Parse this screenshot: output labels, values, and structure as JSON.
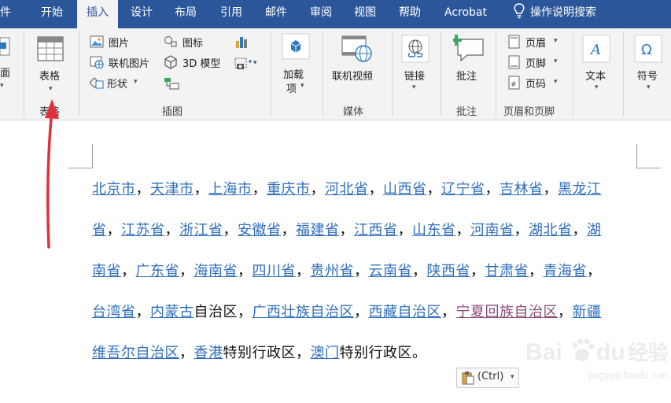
{
  "tabs": [
    {
      "label": "件"
    },
    {
      "label": "开始"
    },
    {
      "label": "插入"
    },
    {
      "label": "设计"
    },
    {
      "label": "布局"
    },
    {
      "label": "引用"
    },
    {
      "label": "邮件"
    },
    {
      "label": "审阅"
    },
    {
      "label": "视图"
    },
    {
      "label": "帮助"
    },
    {
      "label": "Acrobat"
    },
    {
      "label": "操作说明搜索"
    }
  ],
  "ribbon": {
    "cut_label": "面",
    "table": {
      "button": "表格",
      "group": "表格"
    },
    "illustrations": {
      "picture": "图片",
      "online_picture": "联机图片",
      "shapes": "形状",
      "icons": "图标",
      "model3d": "3D 模型",
      "group": "插图"
    },
    "addins": {
      "line1": "加载",
      "line2": "项"
    },
    "media": {
      "online_video": "联机视频",
      "group": "媒体"
    },
    "links": {
      "button": "链接"
    },
    "comments": {
      "button": "批注",
      "group": "批注"
    },
    "header_footer": {
      "header": "页眉",
      "footer": "页脚",
      "page_number": "页码",
      "group": "页眉和页脚"
    },
    "text": {
      "button": "文本"
    },
    "symbols": {
      "button": "符号"
    }
  },
  "document": {
    "lines": [
      [
        {
          "t": "北京市",
          "l": 1
        },
        {
          "t": "，"
        },
        {
          "t": "天津市",
          "l": 1
        },
        {
          "t": "，"
        },
        {
          "t": "上海市",
          "l": 1
        },
        {
          "t": "，"
        },
        {
          "t": "重庆市",
          "l": 1
        },
        {
          "t": "，"
        },
        {
          "t": "河北省",
          "l": 1
        },
        {
          "t": "，"
        },
        {
          "t": "山西省",
          "l": 1
        },
        {
          "t": "，"
        },
        {
          "t": "辽宁省",
          "l": 1
        },
        {
          "t": "，"
        },
        {
          "t": "吉林省",
          "l": 1
        },
        {
          "t": "，"
        },
        {
          "t": "黑龙江",
          "l": 1
        }
      ],
      [
        {
          "t": "省",
          "l": 1
        },
        {
          "t": "，"
        },
        {
          "t": "江苏省",
          "l": 1
        },
        {
          "t": "，"
        },
        {
          "t": "浙江省",
          "l": 1
        },
        {
          "t": "，"
        },
        {
          "t": "安徽省",
          "l": 1
        },
        {
          "t": "，"
        },
        {
          "t": "福建省",
          "l": 1
        },
        {
          "t": "，"
        },
        {
          "t": "江西省",
          "l": 1
        },
        {
          "t": "，"
        },
        {
          "t": "山东省",
          "l": 1
        },
        {
          "t": "，"
        },
        {
          "t": "河南省",
          "l": 1
        },
        {
          "t": "，"
        },
        {
          "t": "湖北省",
          "l": 1
        },
        {
          "t": "，"
        },
        {
          "t": "湖",
          "l": 1
        }
      ],
      [
        {
          "t": "南省",
          "l": 1
        },
        {
          "t": "，"
        },
        {
          "t": "广东省",
          "l": 1
        },
        {
          "t": "，"
        },
        {
          "t": "海南省",
          "l": 1
        },
        {
          "t": "，"
        },
        {
          "t": "四川省",
          "l": 1
        },
        {
          "t": "，"
        },
        {
          "t": "贵州省",
          "l": 1
        },
        {
          "t": "，"
        },
        {
          "t": "云南省",
          "l": 1
        },
        {
          "t": "，"
        },
        {
          "t": "陕西省",
          "l": 1
        },
        {
          "t": "，"
        },
        {
          "t": "甘肃省",
          "l": 1
        },
        {
          "t": "，"
        },
        {
          "t": "青海省",
          "l": 1
        },
        {
          "t": "，"
        }
      ],
      [
        {
          "t": "台湾省",
          "l": 1
        },
        {
          "t": "，"
        },
        {
          "t": "内蒙古",
          "l": 1
        },
        {
          "t": "自治区"
        },
        {
          "t": "，"
        },
        {
          "t": "广西壮族自治区",
          "l": 1
        },
        {
          "t": "，"
        },
        {
          "t": "西藏自治区",
          "l": 1
        },
        {
          "t": "，"
        },
        {
          "t": "宁夏回族自治区",
          "l": 1,
          "v": 1
        },
        {
          "t": "，"
        },
        {
          "t": "新疆",
          "l": 1
        }
      ],
      [
        {
          "t": "维吾尔自治区",
          "l": 1
        },
        {
          "t": "，"
        },
        {
          "t": "香港",
          "l": 1
        },
        {
          "t": "特别行政区"
        },
        {
          "t": "，"
        },
        {
          "t": "澳门",
          "l": 1
        },
        {
          "t": "特别行政区。"
        }
      ]
    ],
    "paste_options": "(Ctrl)"
  },
  "watermark": {
    "brand": "Bai du 经验",
    "url": "jingyan.baidu.com"
  },
  "colors": {
    "ribbon_blue": "#2b579a",
    "link": "#2f6ebd",
    "visited": "#8a4b74",
    "arrow": "#e0303a"
  }
}
